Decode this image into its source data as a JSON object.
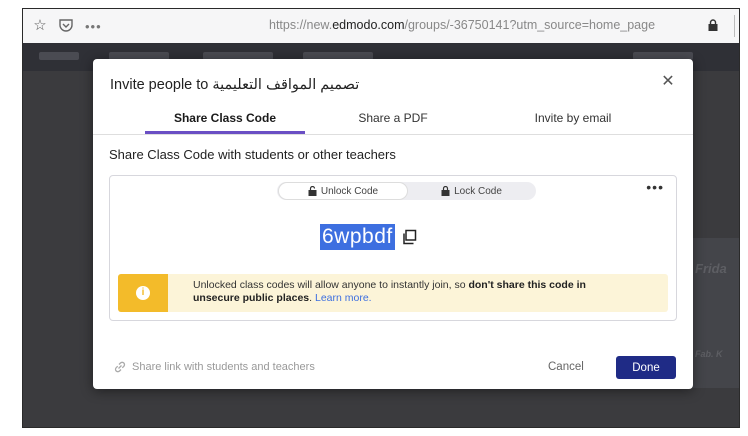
{
  "browser": {
    "url_prefix": "https://new.",
    "url_domain": "edmodo.com",
    "url_suffix": "/groups/-36750141?utm_source=home_page"
  },
  "background": {
    "side_label_1": "Frida",
    "side_label_2": "Fab. K"
  },
  "modal": {
    "title_prefix": "Invite people to",
    "title_group": "تصميم المواقف التعليمية",
    "tabs": [
      {
        "label": "Share Class Code",
        "active": true
      },
      {
        "label": "Share a PDF",
        "active": false
      },
      {
        "label": "Invite by email",
        "active": false
      }
    ],
    "subheading": "Share Class Code with students or other teachers",
    "code_toggle": {
      "unlock_label": "Unlock Code",
      "lock_label": "Lock Code",
      "selected": "unlock"
    },
    "class_code": "6wpbdf",
    "warning": {
      "text_plain": "Unlocked class codes will allow anyone to instantly join, so ",
      "text_bold": "don't share this code in unsecure public places",
      "text_end": ". ",
      "learn_more": "Learn more."
    },
    "share_link_label": "Share link with students and teachers",
    "cancel_label": "Cancel",
    "done_label": "Done"
  },
  "colors": {
    "accent_tab": "#6a4fc4",
    "done_button": "#1f2b86",
    "code_highlight": "#3d6fe0",
    "warning_icon_bg": "#f3bb2a",
    "warning_bg": "#fcf4d8"
  }
}
